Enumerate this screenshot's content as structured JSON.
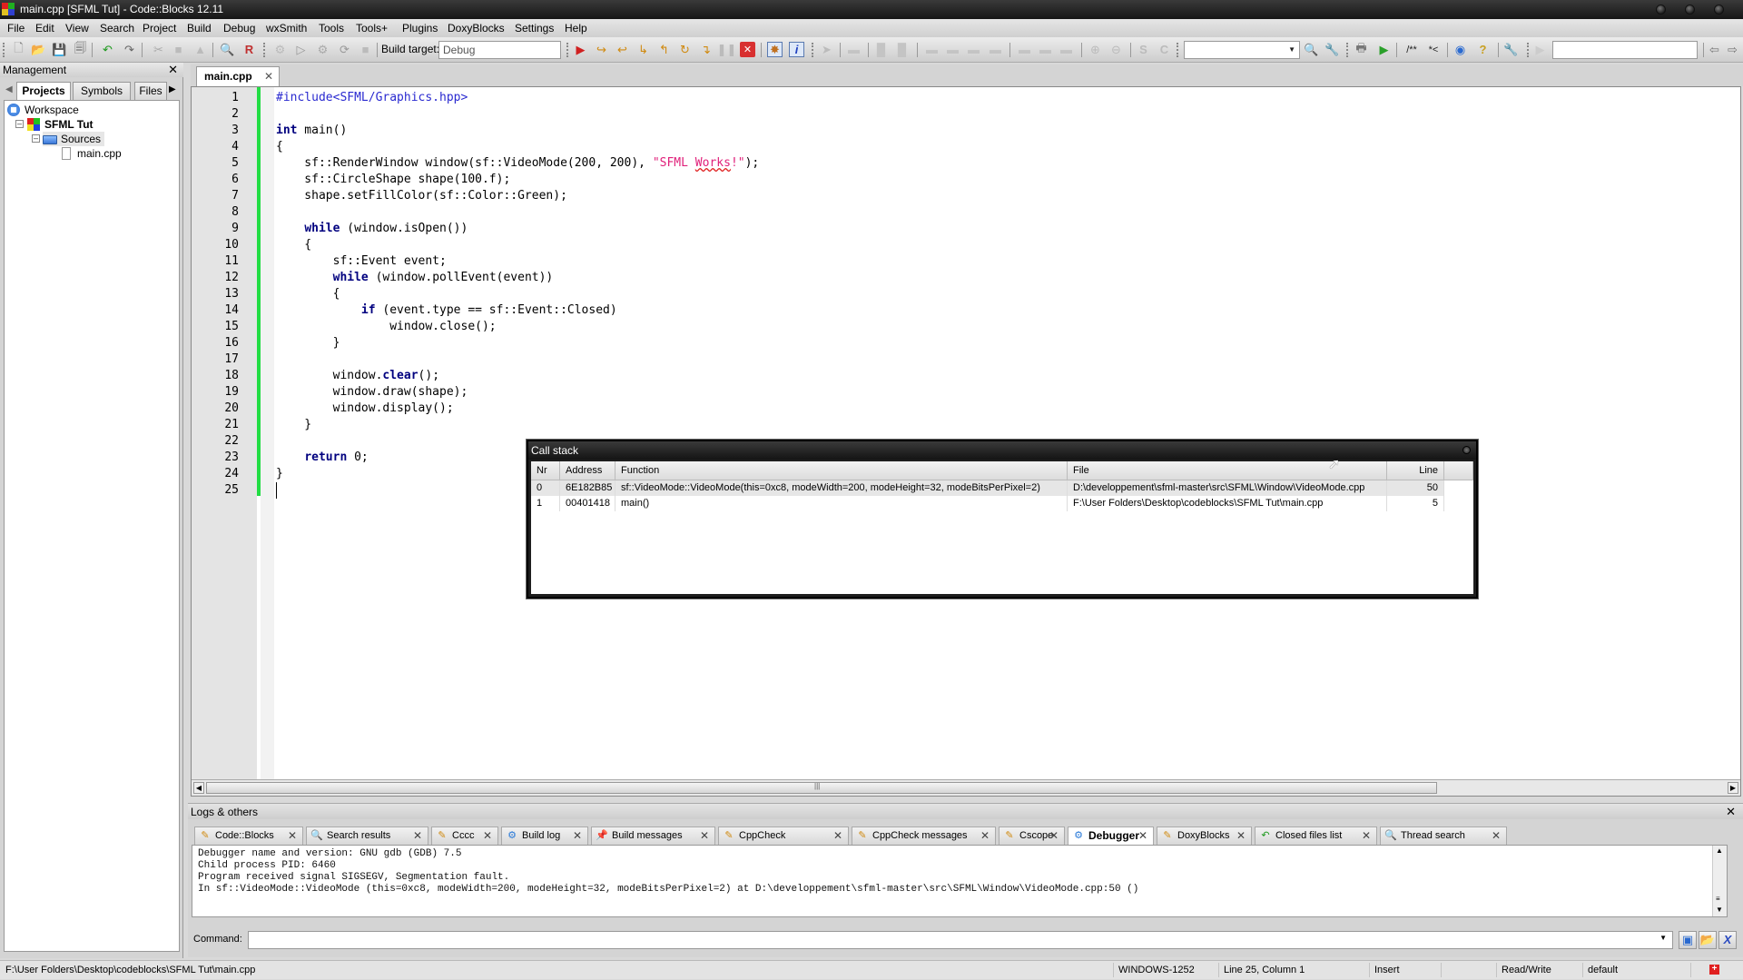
{
  "window": {
    "title": "main.cpp [SFML Tut] - Code::Blocks 12.11"
  },
  "menu": [
    "File",
    "Edit",
    "View",
    "Search",
    "Project",
    "Build",
    "Debug",
    "wxSmith",
    "Tools",
    "Tools+",
    "Plugins",
    "DoxyBlocks",
    "Settings",
    "Help"
  ],
  "toolbar": {
    "build_target_label": "Build target:",
    "build_target_value": "Debug",
    "search_combo_value": "",
    "right_search_value": ""
  },
  "management": {
    "title": "Management",
    "tabs": [
      "Projects",
      "Symbols",
      "Files"
    ],
    "active_tab": "Projects",
    "tree": {
      "workspace": "Workspace",
      "project": "SFML Tut",
      "folder": "Sources",
      "file": "main.cpp"
    }
  },
  "editor": {
    "tab_label": "main.cpp",
    "lines": [
      "#include<SFML/Graphics.hpp>",
      "",
      "int main()",
      "{",
      "    sf::RenderWindow window(sf::VideoMode(200, 200), \"SFML Works!\");",
      "    sf::CircleShape shape(100.f);",
      "    shape.setFillColor(sf::Color::Green);",
      "",
      "    while (window.isOpen())",
      "    {",
      "        sf::Event event;",
      "        while (window.pollEvent(event))",
      "        {",
      "            if (event.type == sf::Event::Closed)",
      "                window.close();",
      "        }",
      "",
      "        window.clear();",
      "        window.draw(shape);",
      "        window.display();",
      "    }",
      "",
      "    return 0;",
      "}",
      ""
    ]
  },
  "callstack": {
    "title": "Call stack",
    "columns": [
      "Nr",
      "Address",
      "Function",
      "File",
      "Line"
    ],
    "rows": [
      {
        "nr": "0",
        "address": "6E182B85",
        "function": "sf::VideoMode::VideoMode(this=0xc8, modeWidth=200, modeHeight=32, modeBitsPerPixel=2)",
        "file": "D:\\developpement\\sfml-master\\src\\SFML\\Window\\VideoMode.cpp",
        "line": "50"
      },
      {
        "nr": "1",
        "address": "00401418",
        "function": "main()",
        "file": "F:\\User Folders\\Desktop\\codeblocks\\SFML Tut\\main.cpp",
        "line": "5"
      }
    ]
  },
  "logs": {
    "title": "Logs & others",
    "tabs": [
      {
        "label": "Code::Blocks",
        "icon": "pencil-icon"
      },
      {
        "label": "Search results",
        "icon": "magnifier-icon"
      },
      {
        "label": "Cccc",
        "icon": "pencil-icon"
      },
      {
        "label": "Build log",
        "icon": "gear-icon"
      },
      {
        "label": "Build messages",
        "icon": "pin-icon"
      },
      {
        "label": "CppCheck",
        "icon": "pencil-icon"
      },
      {
        "label": "CppCheck messages",
        "icon": "pencil-icon"
      },
      {
        "label": "Cscope",
        "icon": "pencil-icon"
      },
      {
        "label": "Debugger",
        "icon": "gear-icon"
      },
      {
        "label": "DoxyBlocks",
        "icon": "pencil-icon"
      },
      {
        "label": "Closed files list",
        "icon": "arrow-icon"
      },
      {
        "label": "Thread search",
        "icon": "magnifier-icon"
      }
    ],
    "active_tab": "Debugger",
    "lines": [
      "Debugger name and version: GNU gdb (GDB) 7.5",
      "Child process PID: 6460",
      "Program received signal SIGSEGV, Segmentation fault.",
      "In sf::VideoMode::VideoMode (this=0xc8, modeWidth=200, modeHeight=32, modeBitsPerPixel=2) at D:\\developpement\\sfml-master\\src\\SFML\\Window\\VideoMode.cpp:50 ()"
    ],
    "command_label": "Command:",
    "command_value": ""
  },
  "statusbar": {
    "path": "F:\\User Folders\\Desktop\\codeblocks\\SFML Tut\\main.cpp",
    "encoding": "WINDOWS-1252",
    "position": "Line 25, Column 1",
    "mode": "Insert",
    "access": "Read/Write",
    "lang": "default"
  }
}
